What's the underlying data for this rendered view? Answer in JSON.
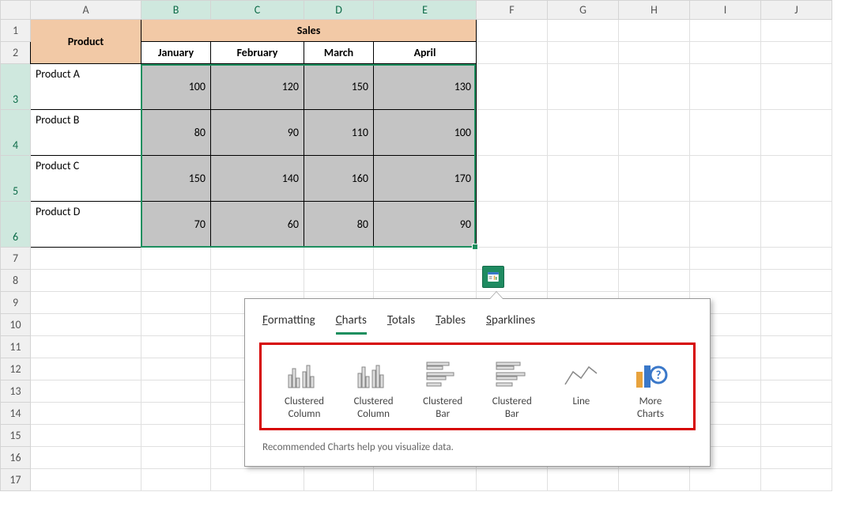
{
  "headers": {
    "cols": [
      "A",
      "B",
      "C",
      "D",
      "E",
      "F",
      "G",
      "H",
      "I",
      "J"
    ],
    "product": "Product",
    "sales": "Sales",
    "months": [
      "January",
      "February",
      "March",
      "April"
    ]
  },
  "rows": [
    {
      "name": "Product A",
      "vals": [
        "100",
        "120",
        "150",
        "130"
      ]
    },
    {
      "name": "Product B",
      "vals": [
        "80",
        "90",
        "110",
        "100"
      ]
    },
    {
      "name": "Product C",
      "vals": [
        "150",
        "140",
        "160",
        "170"
      ]
    },
    {
      "name": "Product D",
      "vals": [
        "70",
        "60",
        "80",
        "90"
      ]
    }
  ],
  "popup": {
    "tabs": {
      "formatting": "ormatting",
      "charts": "harts",
      "totals": "otals",
      "tables": "ables",
      "sparklines": "parklines"
    },
    "tab_prefix": {
      "formatting": "F",
      "charts": "C",
      "totals": "T",
      "tables": "T",
      "sparklines": "S"
    },
    "items": [
      {
        "l1": "Clustered",
        "l2": "Column"
      },
      {
        "l1": "Clustered",
        "l2": "Column"
      },
      {
        "l1": "Clustered",
        "l2": "Bar"
      },
      {
        "l1": "Clustered",
        "l2": "Bar"
      },
      {
        "l1": "Line",
        "l2": ""
      },
      {
        "l1": "More",
        "l2": "Charts"
      }
    ],
    "help": "Recommended Charts help you visualize data."
  }
}
